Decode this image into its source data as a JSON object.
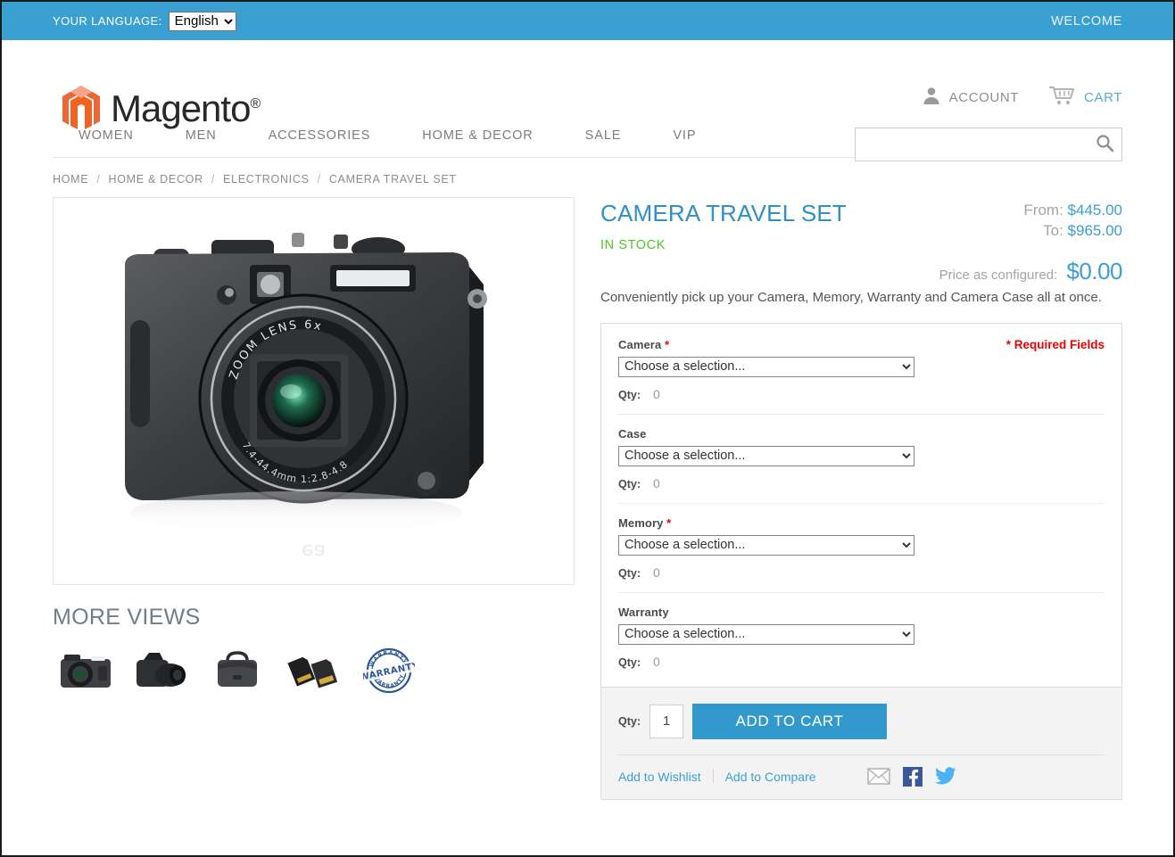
{
  "topbar": {
    "language_label": "YOUR LANGUAGE:",
    "language_value": "English",
    "language_options": [
      "English"
    ],
    "welcome": "WELCOME"
  },
  "header": {
    "brand": "Magento",
    "brand_registered": "®",
    "logo_icon": "magento-hexagon-logo",
    "account_label": "ACCOUNT",
    "account_icon": "user-icon",
    "cart_label": "CART",
    "cart_icon": "shopping-cart-icon",
    "search_value": "",
    "search_placeholder": "",
    "search_icon": "search-icon"
  },
  "nav": {
    "items": [
      {
        "label": "WOMEN"
      },
      {
        "label": "MEN"
      },
      {
        "label": "ACCESSORIES"
      },
      {
        "label": "HOME & DECOR"
      },
      {
        "label": "SALE"
      },
      {
        "label": "VIP"
      }
    ]
  },
  "breadcrumb": {
    "separator": "/",
    "items": [
      {
        "label": "HOME"
      },
      {
        "label": "HOME & DECOR"
      },
      {
        "label": "ELECTRONICS"
      },
      {
        "label": "CAMERA TRAVEL SET"
      }
    ]
  },
  "gallery": {
    "main_image_alt": "digital-camera-front-view",
    "more_views_title": "MORE VIEWS",
    "thumbnails": [
      {
        "name": "compact-camera-thumb"
      },
      {
        "name": "dslr-camera-thumb"
      },
      {
        "name": "camera-bag-thumb"
      },
      {
        "name": "memory-cards-thumb"
      },
      {
        "name": "warranty-stamp-thumb"
      }
    ]
  },
  "product": {
    "title": "CAMERA TRAVEL SET",
    "stock_status": "IN STOCK",
    "price_from_label": "From:",
    "price_from_value": "$445.00",
    "price_to_label": "To:",
    "price_to_value": "$965.00",
    "price_configured_label": "Price as configured:",
    "price_configured_value": "$0.00",
    "description": "Conveniently pick up your Camera, Memory, Warranty and Camera Case all at once."
  },
  "options": {
    "required_note": "* Required Fields",
    "required_marker": "*",
    "qty_label": "Qty:",
    "select_placeholder": "Choose a selection...",
    "groups": [
      {
        "label": "Camera",
        "required": true,
        "selected": "Choose a selection...",
        "qty": "0"
      },
      {
        "label": "Case",
        "required": false,
        "selected": "Choose a selection...",
        "qty": "0"
      },
      {
        "label": "Memory",
        "required": true,
        "selected": "Choose a selection...",
        "qty": "0"
      },
      {
        "label": "Warranty",
        "required": false,
        "selected": "Choose a selection...",
        "qty": "0"
      }
    ]
  },
  "cart": {
    "qty_label": "Qty:",
    "qty_value": "1",
    "add_to_cart_label": "ADD TO CART",
    "wishlist_label": "Add to Wishlist",
    "compare_label": "Add to Compare",
    "share_icons": [
      {
        "name": "email-icon"
      },
      {
        "name": "facebook-icon"
      },
      {
        "name": "twitter-icon"
      }
    ]
  },
  "colors": {
    "accent_blue": "#3399cc",
    "topbar_blue": "#3aa0d1",
    "link_blue": "#3b9fd4",
    "stock_green": "#4bc62a",
    "required_red": "#ee0000",
    "logo_orange": "#ec6737",
    "facebook_blue": "#3b5998",
    "twitter_blue": "#4ab3f4"
  }
}
